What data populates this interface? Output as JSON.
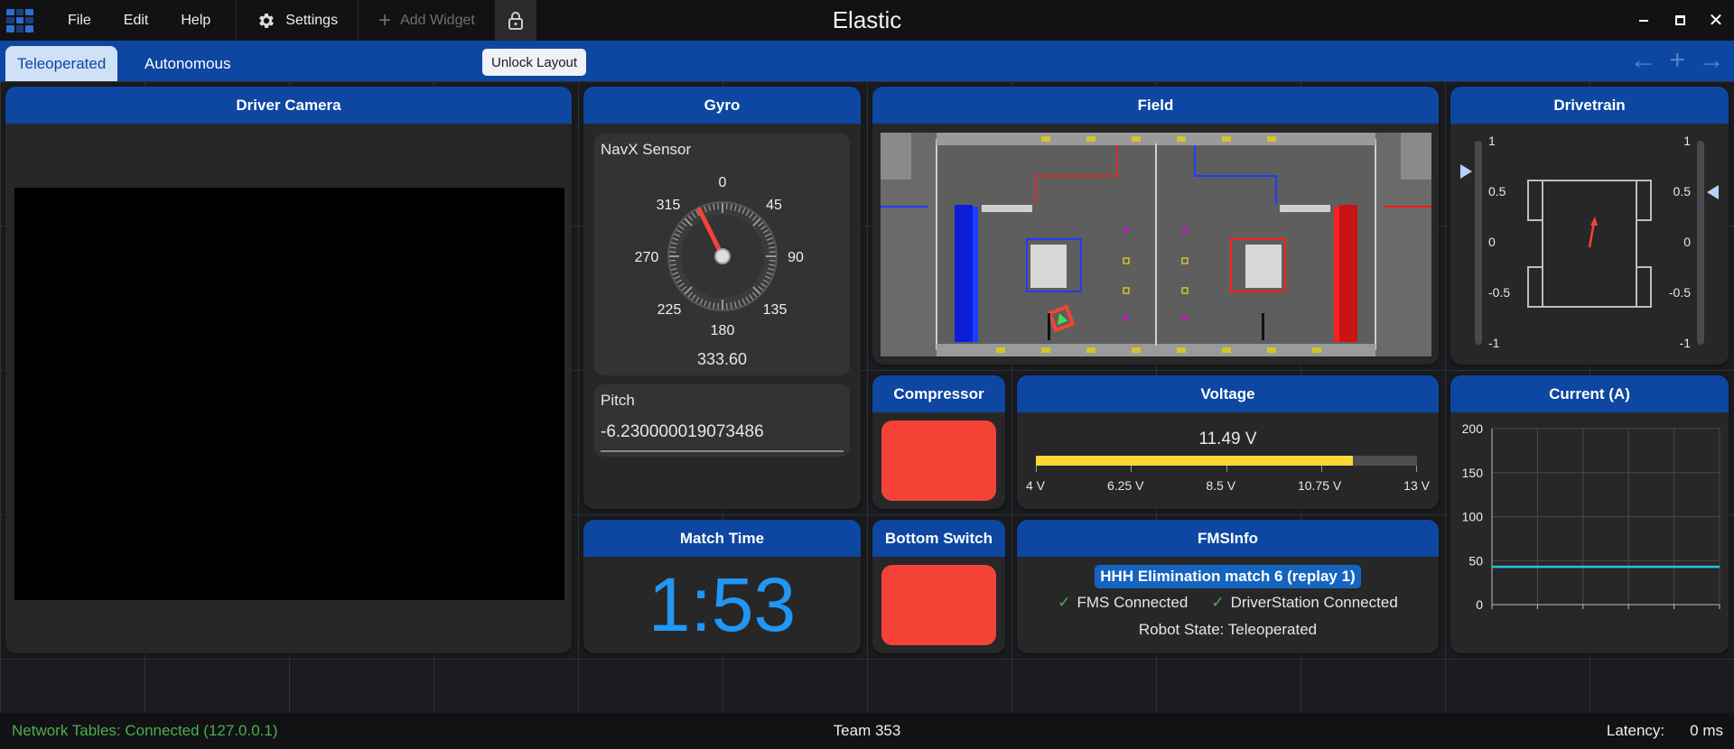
{
  "app": {
    "title": "Elastic"
  },
  "menu": {
    "file": "File",
    "edit": "Edit",
    "help": "Help"
  },
  "toolbar": {
    "settings_label": "Settings",
    "add_widget_label": "Add Widget"
  },
  "tabs": [
    {
      "label": "Teleoperated",
      "active": true
    },
    {
      "label": "Autonomous",
      "active": false
    }
  ],
  "tooltip": {
    "text": "Unlock Layout"
  },
  "widgets": {
    "driver_camera": {
      "title": "Driver Camera"
    },
    "gyro": {
      "title": "Gyro",
      "sensor_label": "NavX Sensor",
      "dial_labels": {
        "n0": "0",
        "n45": "45",
        "n90": "90",
        "n135": "135",
        "n180": "180",
        "n225": "225",
        "n270": "270",
        "n315": "315"
      },
      "heading_value": "333.60",
      "heading_degrees": 333.6,
      "pitch_label": "Pitch",
      "pitch_value": "-6.230000019073486"
    },
    "field": {
      "title": "Field"
    },
    "drivetrain": {
      "title": "Drivetrain",
      "left_scale": [
        "1",
        "0.5",
        "0",
        "-0.5",
        "-1"
      ],
      "right_scale": [
        "1",
        "0.5",
        "0",
        "-0.5",
        "-1"
      ],
      "left_value": 0.7,
      "right_value": 0.5
    },
    "compressor": {
      "title": "Compressor",
      "state_color": "#f44336"
    },
    "voltage": {
      "title": "Voltage",
      "value_text": "11.49 V",
      "value": 11.49,
      "min": 4,
      "max": 13,
      "ticks": [
        "4 V",
        "6.25 V",
        "8.5 V",
        "10.75 V",
        "13 V"
      ],
      "bar_color": "#fdd835"
    },
    "current": {
      "title": "Current (A)",
      "y_ticks": [
        "200",
        "150",
        "100",
        "50",
        "0"
      ],
      "line_color": "#26c6da"
    },
    "match_time": {
      "title": "Match Time",
      "value": "1:53"
    },
    "bottom_switch": {
      "title": "Bottom Switch",
      "state_color": "#f44336"
    },
    "fms_info": {
      "title": "FMSInfo",
      "match_text": "HHH Elimination match 6 (replay 1)",
      "fms_status": "FMS Connected",
      "ds_status": "DriverStation Connected",
      "robot_state": "Robot State: Teleoperated"
    }
  },
  "chart_data": {
    "type": "line",
    "title": "Current (A)",
    "xlabel": "",
    "ylabel": "",
    "ylim": [
      0,
      200
    ],
    "y_ticks": [
      0,
      50,
      100,
      150,
      200
    ],
    "series": [
      {
        "x": [
          0,
          1
        ],
        "values": [
          43,
          43
        ]
      }
    ],
    "grid": true
  },
  "status": {
    "network_tables": "Network Tables: Connected (127.0.0.1)",
    "team": "Team 353",
    "latency_label": "Latency:",
    "latency_value": "0 ms"
  }
}
